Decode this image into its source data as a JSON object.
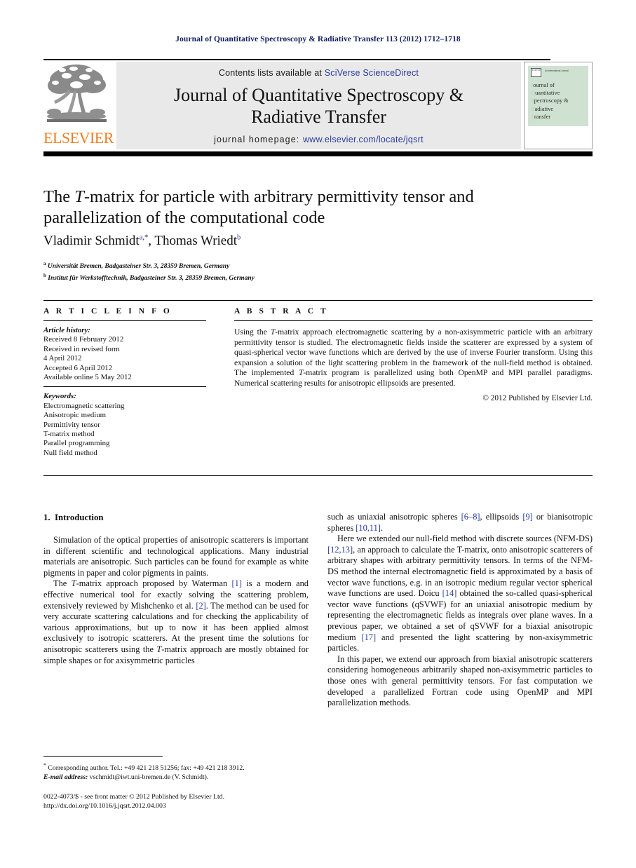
{
  "running_head": "Journal of Quantitative Spectroscopy & Radiative Transfer 113 (2012) 1712–1718",
  "masthead": {
    "publisher": "ELSEVIER",
    "contents_prefix": "Contents lists available at ",
    "sciencedirect_link": "SciVerse ScienceDirect",
    "journal_title_line1": "Journal of Quantitative Spectroscopy &",
    "journal_title_line2": "Radiative Transfer",
    "homepage_prefix": "journal homepage:",
    "homepage_url": "www.elsevier.com/locate/jqsrt",
    "cover": {
      "badge_text": "ELSEVIER",
      "top_text": "An International Journal",
      "line1_cap": "J",
      "line1_rest": "ournal of",
      "line2_cap": "Q",
      "line2_rest": "uantitative",
      "line3_cap": "S",
      "line3_rest": "pectroscopy &",
      "line4_cap": "R",
      "line4_rest": "adiative",
      "line5_cap": "T",
      "line5_rest": "ransfer"
    }
  },
  "article": {
    "title_pre": "The ",
    "title_ital": "T",
    "title_post": "-matrix for particle with arbitrary permittivity tensor and parallelization of the computational code",
    "authors": [
      {
        "name": "Vladimir Schmidt",
        "sup": "a",
        "star": true
      },
      {
        "name": "Thomas Wriedt",
        "sup": "b",
        "star": false
      }
    ],
    "author_separator": ", ",
    "affiliations": [
      {
        "mark": "a",
        "text": "Universität Bremen, Badgasteiner Str. 3, 28359 Bremen, Germany"
      },
      {
        "mark": "b",
        "text": "Institut für Werkstofftechnik, Badgasteiner Str. 3, 28359 Bremen, Germany"
      }
    ]
  },
  "info": {
    "heading": "A R T I C L E   I N F O",
    "history_label": "Article history:",
    "history": [
      "Received 8 February 2012",
      "Received in revised form",
      "4 April 2012",
      "Accepted 6 April 2012",
      "Available online 5 May 2012"
    ],
    "keywords_label": "Keywords:",
    "keywords": [
      "Electromagnetic scattering",
      "Anisotropic medium",
      "Permittivity tensor",
      "T-matrix method",
      "Parallel programming",
      "Null field method"
    ]
  },
  "abstract": {
    "heading": "A B S T R A C T",
    "p1_a": "Using the ",
    "p1_ital1": "T",
    "p1_b": "-matrix approach electromagnetic scattering by a non-axisymmetric particle with an arbitrary permittivity tensor is studied. The electromagnetic fields inside the scatterer are expressed by a system of quasi-spherical vector wave functions which are derived by the use of inverse Fourier transform. Using this expansion a solution of the light scattering problem in the framework of the null-field method is obtained. The implemented ",
    "p1_ital2": "T",
    "p1_c": "-matrix program is parallelized using both OpenMP and MPI parallel paradigms. Numerical scattering results for anisotropic ellipsoids are presented.",
    "copyright": "© 2012 Published by Elsevier Ltd."
  },
  "body": {
    "section_number": "1.",
    "section_title": "Introduction",
    "left_p1": "Simulation of the optical properties of anisotropic scatterers is important in different scientific and technological applications. Many industrial materials are anisotropic. Such particles can be found for example as white pigments in paper and color pigments in paints.",
    "left_p2_a": "The ",
    "left_p2_ital": "T",
    "left_p2_b": "-matrix approach proposed by Waterman ",
    "left_p2_ref1": "[1]",
    "left_p2_c": " is a modern and effective numerical tool for exactly solving the scattering problem, extensively reviewed by Mishchenko et al. ",
    "left_p2_ref2": "[2]",
    "left_p2_d": ". The method can be used for very accurate scattering calculations and for checking the applicability of various approximations, but up to now it has been applied almost exclusively to isotropic scatterers. At the present time the solutions for anisotropic scatterers using the ",
    "left_p2_ital2": "T",
    "left_p2_e": "-matrix approach are mostly obtained for simple shapes or for axisymmetric particles",
    "right_p1_a": "such as uniaxial anisotropic spheres ",
    "right_p1_ref1": "[6–8]",
    "right_p1_b": ", ellipsoids ",
    "right_p1_ref2": "[9]",
    "right_p1_c": " or bianisotropic spheres ",
    "right_p1_ref3": "[10,11]",
    "right_p1_d": ".",
    "right_p2_a": "Here we extended our null-field method with discrete sources (NFM-DS) ",
    "right_p2_ref1": "[12,13]",
    "right_p2_b": ", an approach to calculate the T-matrix, onto anisotropic scatterers of arbitrary shapes with arbitrary permittivity tensors. In terms of the NFM-DS method the internal electromagnetic field is approximated by a basis of vector wave functions, e.g. in an isotropic medium regular vector spherical wave functions are used. Doicu ",
    "right_p2_ref2": "[14]",
    "right_p2_c": " obtained the so-called quasi-spherical vector wave functions (qSVWF) for an uniaxial anisotropic medium by representing the electromagnetic fields as integrals over plane waves. In a previous paper, we obtained a set of qSVWF for a biaxial anisotropic medium ",
    "right_p2_ref3": "[17]",
    "right_p2_d": " and presented the light scattering by non-axisymmetric particles.",
    "right_p3": "In this paper, we extend our approach from biaxial anisotropic scatterers considering homogeneous arbitrarily shaped non-axisymmetric particles to those ones with general permittivity tensors. For fast computation we developed a parallelized Fortran code using OpenMP and MPI parallelization methods."
  },
  "footnote": {
    "marker": "*",
    "corresponding": "Corresponding author. Tel.: +49 421 218 51256; fax: +49 421 218 3912.",
    "email_label": "E-mail address:",
    "email_value": " vschmidt@iwt.uni-bremen.de (V. Schmidt)."
  },
  "imprint": {
    "line1": "0022-4073/$ - see front matter © 2012 Published by Elsevier Ltd.",
    "line2": "http://dx.doi.org/10.1016/j.jqsrt.2012.04.003"
  },
  "colors": {
    "link": "#2a3a9c",
    "running_head": "#13205e",
    "elsevier_orange": "#eb8023",
    "banner_gray": "#e9e9e9",
    "cover_green": "#cfe2d2"
  }
}
